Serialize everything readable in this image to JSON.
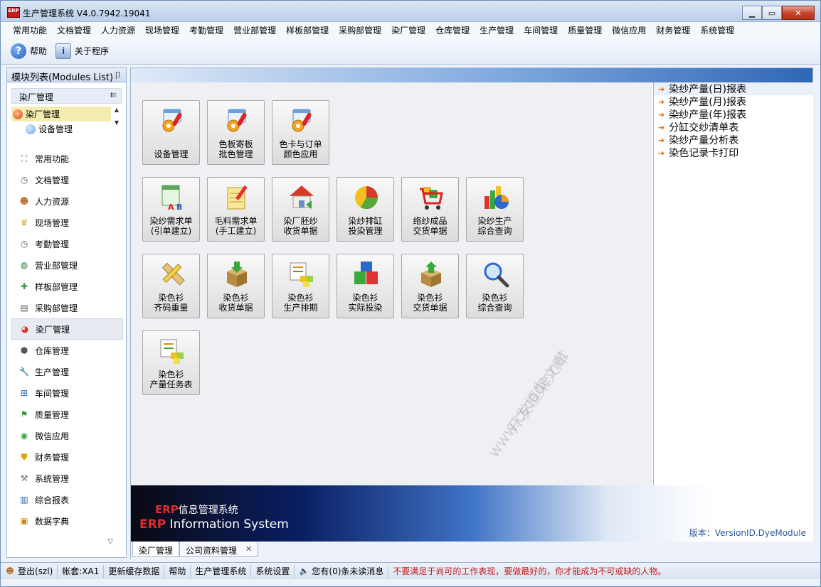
{
  "window": {
    "title": "生产管理系统 V4.0.7942.19041",
    "icon_text": "ERP"
  },
  "menubar": [
    "常用功能",
    "文档管理",
    "人力资源",
    "现场管理",
    "考勤管理",
    "营业部管理",
    "样板部管理",
    "采购部管理",
    "染厂管理",
    "仓库管理",
    "生产管理",
    "车间管理",
    "质量管理",
    "微信应用",
    "财务管理",
    "系统管理"
  ],
  "toolbar": {
    "help_label": "帮助",
    "about_label": "关于程序"
  },
  "leftpanel": {
    "header": "模块列表(Modules List)",
    "pin": "卩",
    "category": "染厂管理",
    "collapse": "⇇",
    "tree": [
      {
        "label": "染厂管理"
      },
      {
        "label": "设备管理"
      }
    ],
    "modules": [
      {
        "label": "常用功能",
        "icon": "grid-icon"
      },
      {
        "label": "文档管理",
        "icon": "clock-icon"
      },
      {
        "label": "人力资源",
        "icon": "people-icon"
      },
      {
        "label": "现场管理",
        "icon": "crown-icon"
      },
      {
        "label": "考勤管理",
        "icon": "clock-icon"
      },
      {
        "label": "营业部管理",
        "icon": "globe-icon"
      },
      {
        "label": "样板部管理",
        "icon": "puzzle-icon"
      },
      {
        "label": "采购部管理",
        "icon": "list-icon"
      },
      {
        "label": "染厂管理",
        "icon": "pie-icon"
      },
      {
        "label": "仓库管理",
        "icon": "box-icon"
      },
      {
        "label": "生产管理",
        "icon": "wrench-icon"
      },
      {
        "label": "车间管理",
        "icon": "org-icon"
      },
      {
        "label": "质量管理",
        "icon": "flag-icon"
      },
      {
        "label": "微信应用",
        "icon": "chat-icon"
      },
      {
        "label": "财务管理",
        "icon": "shield-icon"
      },
      {
        "label": "系统管理",
        "icon": "tools-icon"
      },
      {
        "label": "综合报表",
        "icon": "bar-chart-icon"
      },
      {
        "label": "数据字典",
        "icon": "book-icon"
      }
    ]
  },
  "buttons": [
    {
      "line1": "",
      "line2": "设备管理",
      "icon": "gear-card-icon"
    },
    {
      "line1": "色板寄板",
      "line2": "批色管理",
      "icon": "gear-card-icon"
    },
    {
      "line1": "色卡与订单",
      "line2": "颜色应用",
      "icon": "gear-card-icon"
    },
    {
      "line1": "染纱需求单",
      "line2": "(引单建立)",
      "icon": "order-abc-icon"
    },
    {
      "line1": "毛料需求单",
      "line2": "(手工建立)",
      "icon": "notepad-icon"
    },
    {
      "line1": "染厂胚纱",
      "line2": "收货单据",
      "icon": "house-icon"
    },
    {
      "line1": "染纱排缸",
      "line2": "投染管理",
      "icon": "pie-icon"
    },
    {
      "line1": "络纱成品",
      "line2": "交货单据",
      "icon": "cart-icon"
    },
    {
      "line1": "染纱生产",
      "line2": "综合查询",
      "icon": "chart-pie-icon"
    },
    {
      "line1": "染色衫",
      "line2": "齐码重量",
      "icon": "ruler-pencil-icon"
    },
    {
      "line1": "染色衫",
      "line2": "收货单据",
      "icon": "box-down-icon"
    },
    {
      "line1": "染色衫",
      "line2": "生产排期",
      "icon": "task-cubes-icon"
    },
    {
      "line1": "染色衫",
      "line2": "实际投染",
      "icon": "cubes-icon"
    },
    {
      "line1": "染色衫",
      "line2": "交货单据",
      "icon": "box-up-icon"
    },
    {
      "line1": "染色衫",
      "line2": "综合查询",
      "icon": "magnifier-icon"
    },
    {
      "line1": "染色衫",
      "line2": "产量任务表",
      "icon": "task-cubes-icon"
    }
  ],
  "reports": [
    "染纱产量(日)报表",
    "染纱产量(月)报表",
    "染纱产量(年)报表",
    "分缸交纱清单表",
    "染纱产量分析表",
    " 染色记录卡打印"
  ],
  "banner": {
    "cn_erp": "ERP",
    "cn_text": "信息管理系统",
    "en_erp": "ERP",
    "en_text": " Information System",
    "version": "版本：VersionID.DyeModule"
  },
  "watermark": {
    "line1": "www.cscode.net",
    "line2": "开发框架文库"
  },
  "tabs": [
    {
      "label": "染厂管理",
      "closable": false
    },
    {
      "label": "公司资料管理",
      "closable": true
    }
  ],
  "statusbar": {
    "login": "登出(szl)",
    "account": "帐套:XA1",
    "refresh": "更新缓存数据",
    "help": "帮助",
    "system": "生产管理系统",
    "settings": "系统设置",
    "messages": "您有(0)条未读消息",
    "motto": "不要满足于尚可的工作表现，要做最好的，你才能成为不可或缺的人物。"
  },
  "colors": {
    "accent_red": "#c11b1b",
    "report_arrow": "#e0701a",
    "banner_dark": "#0a1f63"
  }
}
